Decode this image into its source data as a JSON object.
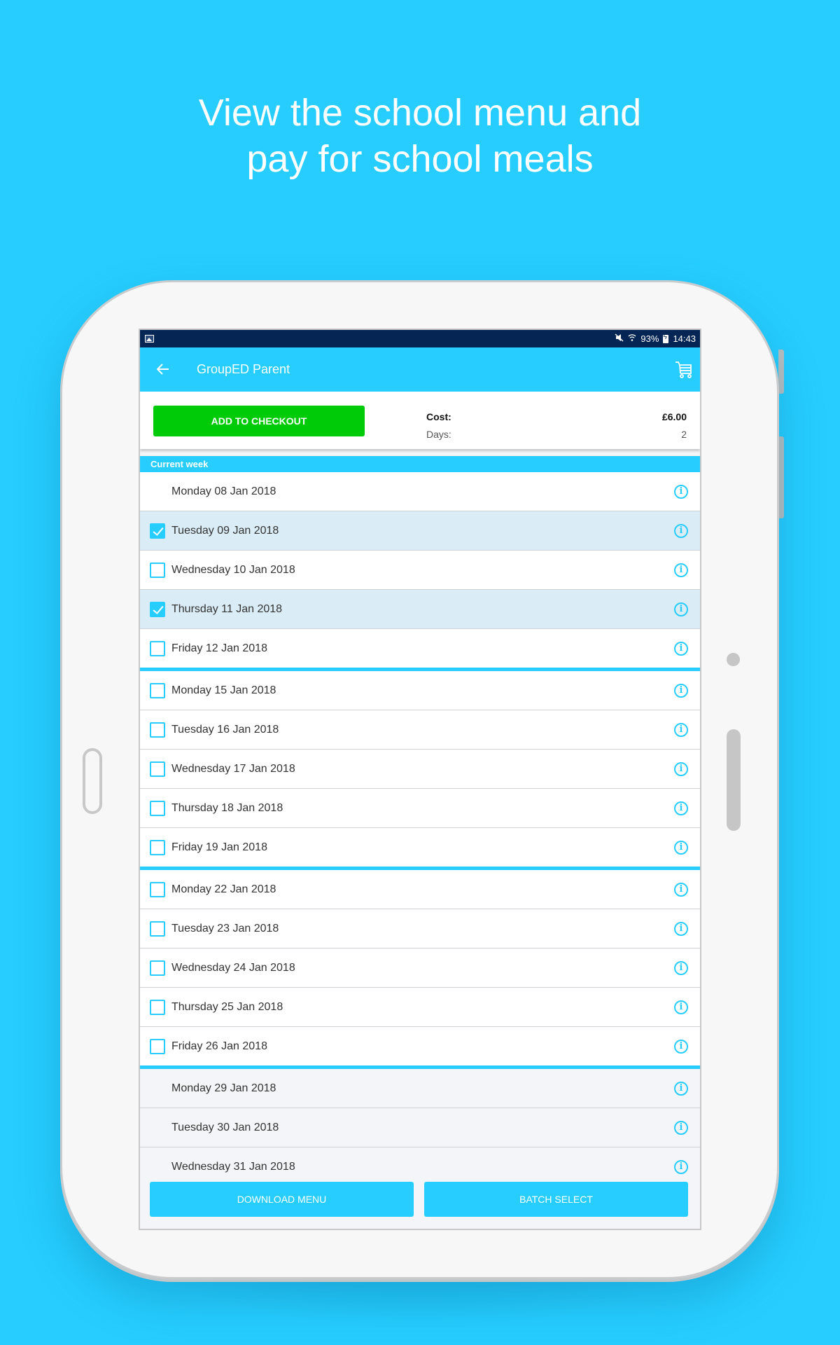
{
  "promo": {
    "headline_line1": "View the school menu and",
    "headline_line2": "pay for school meals"
  },
  "colors": {
    "background": "#26cdfe",
    "accent": "#26cdfe",
    "status_bar": "#052654",
    "checkout_button": "#00cb08",
    "selected_row": "#daecf6"
  },
  "status_bar": {
    "left_icon": "image-notification-icon",
    "icons": [
      "mute-icon",
      "wifi-icon",
      "battery-charging-icon"
    ],
    "battery": "93%",
    "time": "14:43"
  },
  "app_bar": {
    "back_icon": "arrow-left-icon",
    "title": "GroupED Parent",
    "cart_icon": "shopping-cart-icon"
  },
  "checkout": {
    "button_label": "ADD TO CHECKOUT",
    "cost_label": "Cost:",
    "cost_value": "£6.00",
    "days_label": "Days:",
    "days_value": "2"
  },
  "week_header": "Current week",
  "weeks": [
    {
      "days": [
        {
          "label": "Monday 08 Jan 2018",
          "checkbox": "none",
          "state": "normal"
        },
        {
          "label": "Tuesday 09 Jan 2018",
          "checkbox": "checked",
          "state": "selected"
        },
        {
          "label": "Wednesday 10 Jan 2018",
          "checkbox": "unchecked",
          "state": "normal"
        },
        {
          "label": "Thursday 11 Jan 2018",
          "checkbox": "checked",
          "state": "selected"
        },
        {
          "label": "Friday 12 Jan 2018",
          "checkbox": "unchecked",
          "state": "normal"
        }
      ]
    },
    {
      "days": [
        {
          "label": "Monday 15 Jan 2018",
          "checkbox": "unchecked",
          "state": "normal"
        },
        {
          "label": "Tuesday 16 Jan 2018",
          "checkbox": "unchecked",
          "state": "normal"
        },
        {
          "label": "Wednesday 17 Jan 2018",
          "checkbox": "unchecked",
          "state": "normal"
        },
        {
          "label": "Thursday 18 Jan 2018",
          "checkbox": "unchecked",
          "state": "normal"
        },
        {
          "label": "Friday 19 Jan 2018",
          "checkbox": "unchecked",
          "state": "normal"
        }
      ]
    },
    {
      "days": [
        {
          "label": "Monday 22 Jan 2018",
          "checkbox": "unchecked",
          "state": "normal"
        },
        {
          "label": "Tuesday 23 Jan 2018",
          "checkbox": "unchecked",
          "state": "normal"
        },
        {
          "label": "Wednesday 24 Jan 2018",
          "checkbox": "unchecked",
          "state": "normal"
        },
        {
          "label": "Thursday 25 Jan 2018",
          "checkbox": "unchecked",
          "state": "normal"
        },
        {
          "label": "Friday 26 Jan 2018",
          "checkbox": "unchecked",
          "state": "normal"
        }
      ]
    },
    {
      "days": [
        {
          "label": "Monday 29 Jan 2018",
          "checkbox": "none",
          "state": "past"
        },
        {
          "label": "Tuesday 30 Jan 2018",
          "checkbox": "none",
          "state": "past"
        },
        {
          "label": "Wednesday 31 Jan 2018",
          "checkbox": "none",
          "state": "past"
        }
      ]
    }
  ],
  "bottom_buttons": {
    "download_menu": "DOWNLOAD MENU",
    "batch_select": "BATCH SELECT"
  }
}
